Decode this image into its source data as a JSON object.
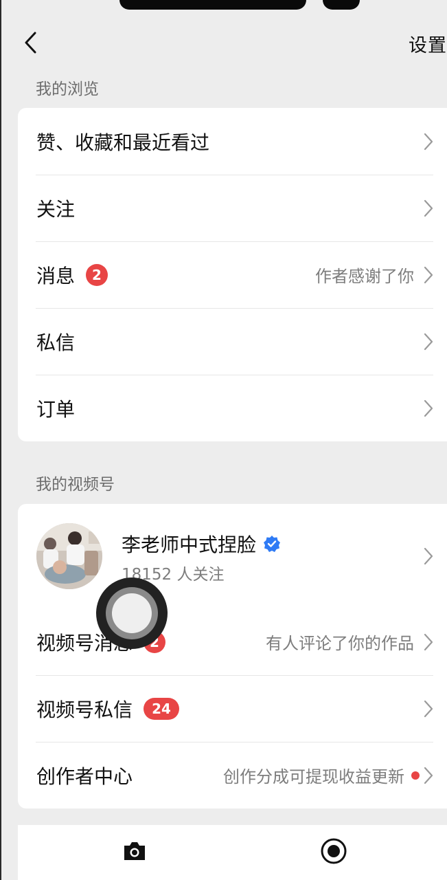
{
  "header": {
    "settings_label": "设置"
  },
  "browse_section": {
    "label": "我的浏览",
    "items": [
      {
        "title": "赞、收藏和最近看过",
        "right": ""
      },
      {
        "title": "关注",
        "right": ""
      },
      {
        "title": "消息",
        "badge": "2",
        "right": "作者感谢了你"
      },
      {
        "title": "私信",
        "right": ""
      },
      {
        "title": "订单",
        "right": ""
      }
    ]
  },
  "channels_section": {
    "label": "我的视频号",
    "profile": {
      "name": "李老师中式捏脸",
      "followers": "18152 人关注",
      "verified": true
    },
    "items": [
      {
        "title": "视频号消息",
        "badge": "2",
        "right": "有人评论了你的作品"
      },
      {
        "title": "视频号私信",
        "badge": "24",
        "right": ""
      },
      {
        "title": "创作者中心",
        "right": "创作分成可提现收益更新",
        "dot": true
      }
    ]
  },
  "colors": {
    "badge": "#e84545",
    "verified": "#2f7bf5",
    "background": "#ededed"
  },
  "bottom_icons": [
    "camera-icon",
    "record-icon"
  ]
}
